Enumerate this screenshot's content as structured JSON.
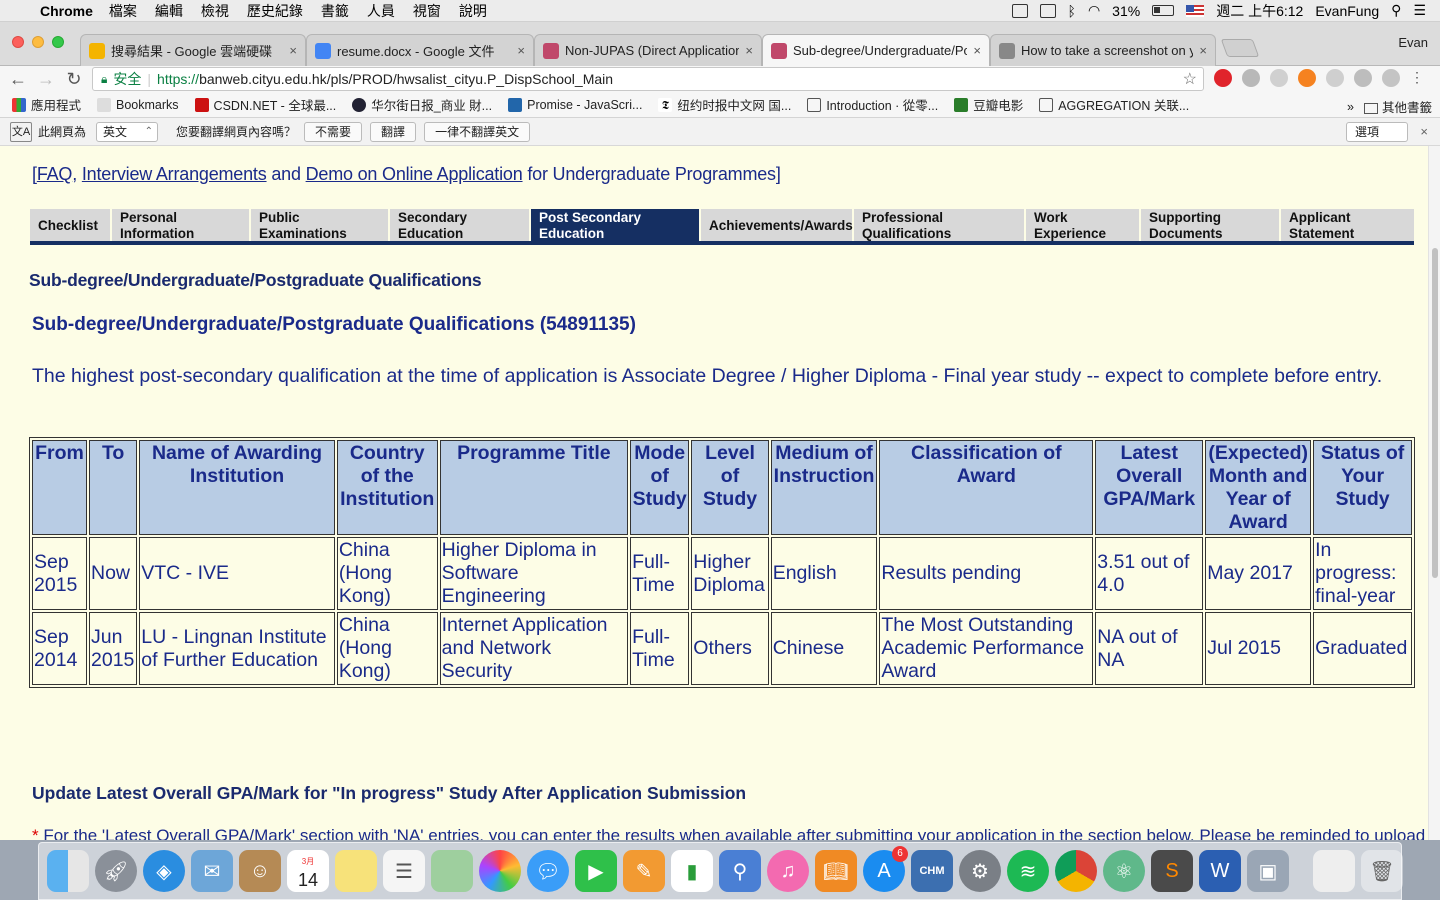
{
  "menubar": {
    "app": "Chrome",
    "items": [
      "檔案",
      "編輯",
      "檢視",
      "歷史紀錄",
      "書籤",
      "人員",
      "視窗",
      "說明"
    ],
    "battery": "31%",
    "clock": "週二 上午6:12",
    "user": "EvanFung"
  },
  "tabs": [
    {
      "title": "搜尋結果 - Google 雲端硬碟",
      "close": "×",
      "color": "#f4b400"
    },
    {
      "title": "resume.docx - Google 文件",
      "close": "×",
      "color": "#4285f4"
    },
    {
      "title": "Non-JUPAS (Direct Application",
      "close": "×",
      "color": "#c0486a"
    },
    {
      "title": "Sub-degree/Undergraduate/Po",
      "close": "×",
      "color": "#c0486a"
    },
    {
      "title": "How to take a screenshot on y",
      "close": "×",
      "color": "#888888"
    }
  ],
  "profile": "Evan",
  "address": {
    "secure_label": "安全",
    "url_scheme": "https://",
    "url_rest": "banweb.cityu.edu.hk/pls/PROD/hwsalist_cityu.P_DispSchool_Main"
  },
  "bookmarks": {
    "apps": "應用程式",
    "items": [
      "Bookmarks",
      "CSDN.NET - 全球最...",
      "华尔街日报_商业 財...",
      "Promise - JavaScri...",
      "纽约时报中文网 国...",
      "Introduction · 從零...",
      "豆瓣电影",
      "AGGREGATION 关联..."
    ],
    "more": "»",
    "other": "其他書籤"
  },
  "translate": {
    "prefix": "此網頁為",
    "language": "英文",
    "question": "您要翻譯網頁內容嗎？",
    "no": "不需要",
    "translate": "翻譯",
    "never": "一律不翻譯英文",
    "options": "選項",
    "close": "×"
  },
  "page": {
    "links": {
      "open": "[",
      "faq": "FAQ",
      "comma": ", ",
      "interview": "Interview Arrangements",
      "and1": " and ",
      "demo": "Demo on Online Application",
      "tail": " for Undergraduate Programmes]"
    },
    "nav_tabs": [
      "Checklist",
      "Personal Information",
      "Public Examinations",
      "Secondary Education",
      "Post Secondary Education",
      "Achievements/Awards",
      "Professional Qualifications",
      "Work Experience",
      "Supporting Documents",
      "Applicant Statement"
    ],
    "section_title": "Sub-degree/Undergraduate/Postgraduate Qualifications",
    "subsection_title": "Sub-degree/Undergraduate/Postgraduate Qualifications (54891135)",
    "paragraph": "The highest post-secondary qualification at the time of application is Associate Degree / Higher Diploma - Final year study -- expect to complete before entry.",
    "table": {
      "headers": [
        "From",
        "To",
        "Name of Awarding Institution",
        "Country of the Institution",
        "Programme Title",
        "Mode of Study",
        "Level of Study",
        "Medium of Instruction",
        "Classification of Award",
        "Latest Overall GPA/Mark",
        "(Expected) Month and Year of Award",
        "Status of Your Study"
      ],
      "rows": [
        [
          "Sep 2015",
          "Now",
          "VTC - IVE",
          "China (Hong Kong)",
          "Higher Diploma in Software Engineering",
          "Full-Time",
          "Higher Diploma",
          "English",
          "Results pending",
          "3.51 out of 4.0",
          "May 2017",
          "In progress: final-year"
        ],
        [
          "Sep 2014",
          "Jun 2015",
          "LU - Lingnan Institute of Further Education",
          "China (Hong Kong)",
          "Internet Application and Network Security",
          "Full-Time",
          "Others",
          "Chinese",
          "The Most Outstanding Academic Performance Award",
          "NA out of NA",
          "Jul 2015",
          "Graduated"
        ]
      ]
    },
    "update_title": "Update Latest Overall GPA/Mark for \"In progress\" Study After Application Submission",
    "note_asterisk": "*",
    "note": " For the 'Latest Overall GPA/Mark' section with 'NA' entries, you can enter the results when available after submitting your application in the section below. Please be reminded to upload"
  },
  "dock": {
    "items": [
      "Finder",
      "Launchpad",
      "Safari",
      "Mail",
      "Contacts",
      "Calendar",
      "Notes",
      "Reminders",
      "Preview",
      "Photos",
      "Messages",
      "FaceTime",
      "Pages",
      "Numbers",
      "Keynote",
      "iTunes",
      "iBooks",
      "App Store",
      "CHM",
      "System Preferences",
      "Spotify",
      "Chrome",
      "Atom",
      "Sublime Text",
      "Word",
      "Image Capture",
      "Downloads",
      "Trash"
    ],
    "calendar_month": "3月",
    "calendar_day": "14",
    "appstore_badge": "6",
    "chm_label": "CHM"
  }
}
